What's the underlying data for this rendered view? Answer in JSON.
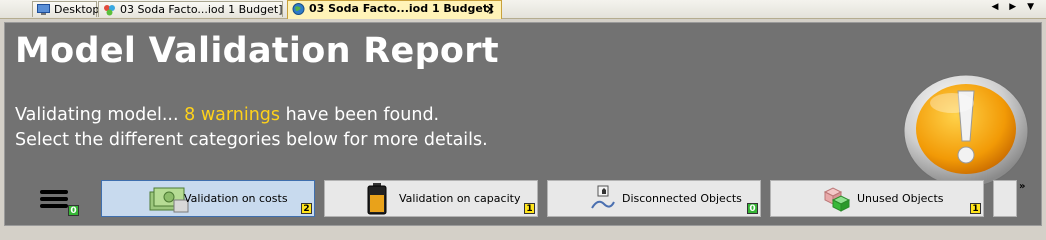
{
  "tabs": [
    {
      "label": "Desktop",
      "icon": "desktop-icon",
      "active": false
    },
    {
      "label": "03 Soda Facto...iod 1 Budget]",
      "icon": "model-icon",
      "active": false
    },
    {
      "label": "03 Soda Facto...iod 1 Budget]",
      "icon": "globe-icon",
      "active": true
    }
  ],
  "tab_close": "×",
  "tab_scroll": "◀ ▶ ▼",
  "report": {
    "title": "Model Validation Report",
    "line1_prefix": "Validating model... ",
    "line1_warn": "8 warnings",
    "line1_suffix": " have been found.",
    "line2": "Select the different categories below for more details.",
    "warn_color": "#ffd21a"
  },
  "menu": {
    "count": "0"
  },
  "categories": [
    {
      "label": "Validation on costs",
      "count": "2",
      "badge": "yellow",
      "icon": "money-icon",
      "selected": true
    },
    {
      "label": "Validation on capacity",
      "count": "1",
      "badge": "yellow",
      "icon": "battery-icon",
      "selected": false
    },
    {
      "label": "Disconnected Objects",
      "count": "0",
      "badge": "green",
      "icon": "disconnected-icon",
      "selected": false
    },
    {
      "label": "Unused Objects",
      "count": "1",
      "badge": "yellow",
      "icon": "cubes-icon",
      "selected": false
    }
  ],
  "more_label": "»"
}
